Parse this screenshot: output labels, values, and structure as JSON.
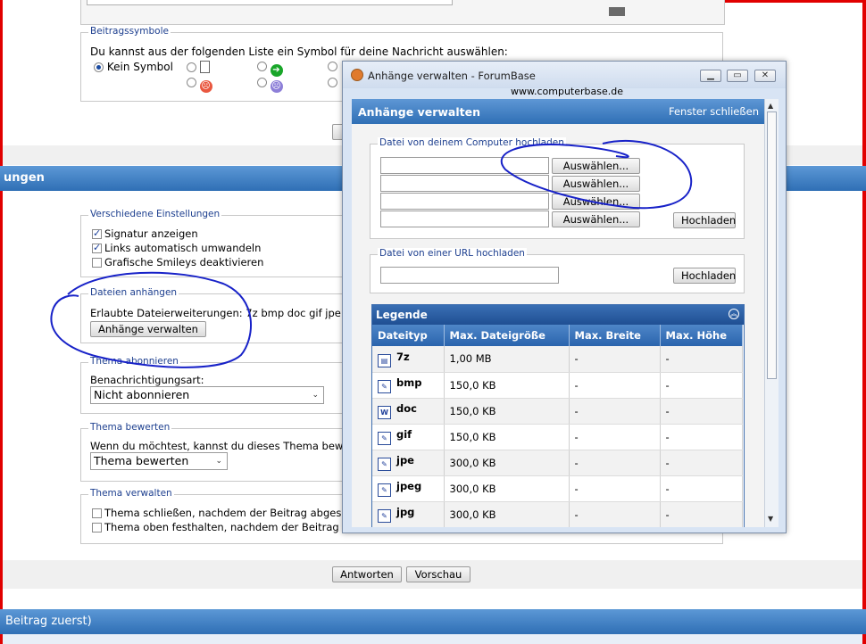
{
  "page": {
    "beitragssymbole": {
      "legend": "Beitragssymbole",
      "instruction": "Du kannst aus der folgenden Liste ein Symbol für deine Nachricht auswählen:",
      "none_label": "Kein Symbol"
    },
    "section_header_left": "ungen",
    "verschiedene": {
      "legend": "Verschiedene Einstellungen",
      "signatur": "Signatur anzeigen",
      "links": "Links automatisch umwandeln",
      "smileys": "Grafische Smileys deaktivieren"
    },
    "dateien": {
      "legend": "Dateien anhängen",
      "allowed": "Erlaubte Dateierweiterungen: 7z bmp doc gif jpe",
      "button": "Anhänge verwalten"
    },
    "abonnieren": {
      "legend": "Thema abonnieren",
      "label": "Benachrichtigungsart:",
      "selected": "Nicht abonnieren"
    },
    "bewerten": {
      "legend": "Thema bewerten",
      "text": "Wenn du möchtest, kannst du dieses Thema bewe",
      "selected": "Thema bewerten"
    },
    "verwalten": {
      "legend": "Thema verwalten",
      "close": "Thema schließen, nachdem der Beitrag abges",
      "sticky": "Thema oben festhalten, nachdem der Beitrag a"
    },
    "buttons": {
      "reply": "Antworten",
      "preview": "Vorschau"
    },
    "footer_bar": "Beitrag zuerst)"
  },
  "popup": {
    "title": "Anhänge verwalten - ForumBase",
    "url": "www.computerbase.de",
    "header": "Anhänge verwalten",
    "close_link": "Fenster schließen",
    "upload_legend": "Datei von deinem Computer hochladen",
    "choose_label": "Auswählen...",
    "upload_button": "Hochladen",
    "url_legend": "Datei von einer URL hochladen",
    "legende_title": "Legende",
    "columns": [
      "Dateityp",
      "Max. Dateigröße",
      "Max. Breite",
      "Max. Höhe"
    ],
    "rows": [
      {
        "type": "7z",
        "size": "1,00 MB",
        "w": "-",
        "h": "-",
        "icon": "archive-icon"
      },
      {
        "type": "bmp",
        "size": "150,0 KB",
        "w": "-",
        "h": "-",
        "icon": "image-file-icon"
      },
      {
        "type": "doc",
        "size": "150,0 KB",
        "w": "-",
        "h": "-",
        "icon": "word-doc-icon"
      },
      {
        "type": "gif",
        "size": "150,0 KB",
        "w": "-",
        "h": "-",
        "icon": "image-file-icon"
      },
      {
        "type": "jpe",
        "size": "300,0 KB",
        "w": "-",
        "h": "-",
        "icon": "image-file-icon"
      },
      {
        "type": "jpeg",
        "size": "300,0 KB",
        "w": "-",
        "h": "-",
        "icon": "image-file-icon"
      },
      {
        "type": "jpg",
        "size": "300,0 KB",
        "w": "-",
        "h": "-",
        "icon": "image-file-icon"
      }
    ]
  },
  "colors": {
    "accent_blue": "#2f6fb5",
    "annotation_blue": "#1822c8",
    "frame_red": "#e10000"
  }
}
